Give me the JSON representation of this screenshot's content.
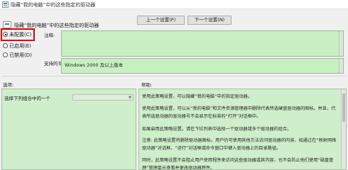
{
  "window": {
    "title": "隐藏“我的电脑”中的这些指定的驱动器"
  },
  "header": {
    "policy_name": "隐藏“我的电脑”中的这些指定的驱动器",
    "prev_label": "上一个设置(P)",
    "next_label": "下一个设置(N)"
  },
  "state": {
    "selected": "未配置(C)",
    "not_configured_label": "未配置(C)",
    "enabled_label": "已启用(E)",
    "disabled_label": "已禁用(D)"
  },
  "comment": {
    "label": "注释:",
    "value": ""
  },
  "supported": {
    "label": "支持的平台:",
    "value": "Windows 2000 及以上版本"
  },
  "options": {
    "label": "选项:",
    "select_text": "选择下列组合中的一个",
    "dropdown_value": ""
  },
  "help": {
    "label": "帮助:",
    "paragraphs": [
      "使用此策略设置，可以隐藏“我的电脑”中的指定驱动器。",
      "使用此策略设置，可以从“我的电脑”和文件资源管理器中删除代表所选硬盘驱动器的图标。并且，代表所选驱动器的驱动器号不会显示在标准的“打开”对话框中。",
      "如果启用此策略设置，请在下拉列表中选择一个驱动器或多个驱动器的组合。",
      "注意: 此策略设置将删除驱动器图标。用户仍可使用其他方法访问驱动器的内容，如通过在“映射网络驱动器”对话框、“运行”对话框或命令窗口中键入驱动器上的目录路径。",
      "同时，此策略设置不会阻止用户使用程序来访问这些驱动器或其内容，也不会防止他们使用“磁盘管理”管理单元查看并更改驱动器特性。"
    ]
  }
}
